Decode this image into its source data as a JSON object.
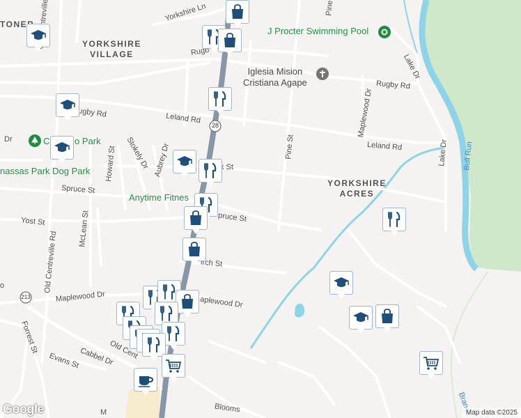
{
  "map": {
    "areas": [
      {
        "id": "yorkshire-village",
        "line1": "YORKSHIRE",
        "line2": "VILLAGE"
      },
      {
        "id": "yorkshire-acres",
        "line1": "YORKSHIRE",
        "line2": "ACRES"
      },
      {
        "id": "toner-partial",
        "line1": "TONER",
        "line2": ""
      }
    ],
    "streets": {
      "yorkshire_ln": "Yorkshire Ln",
      "old_centreville_rd": "Old Centreville Rd",
      "old_centreville_rd_2": "Old Centreville Rd",
      "rugby_partial": "Rugb",
      "rugby_rd_left": "ugby Rd",
      "rugby_rd_right": "Rugby Rd",
      "leland_rd_left": "Leland Rd",
      "leland_rd_right": "Leland Rd",
      "lake_dr_top": "Lake Dr",
      "lake_dr_right": "Lake Dr",
      "maplewood_dr_ne": "Maplewood Dr",
      "maplewood_dr_left": "Maplewood Dr",
      "maplewood_dr_mid": "aplewood Dr",
      "pine_st_top": "Pine",
      "pine_st": "Pine St",
      "howard_st": "Howard St",
      "stokely_dr": "Stokely Dr",
      "aubrey_dr": "Aubrey Dr",
      "spruce_st_left": "Spruce St",
      "spruce_st_mid": "pruce St",
      "yost_st": "Yost St",
      "mclean_st": "McLean St",
      "birch_st": "irch St",
      "k_st": "k St",
      "evans_st": "Evans St",
      "cabbel_dr": "Cabbel Dr",
      "forrest_st": "Forrest St",
      "blooms": "Blooms",
      "old_cent_partial": "Old Cent",
      "dr_partial": "Dr",
      "m_partial": "M",
      "branch": "Branch",
      "o_partial": "o"
    },
    "pois": {
      "swimming_pool": "J Procter Swimming Pool",
      "church_line1": "Iglesia Mision",
      "church_line2": "Cristiana Agape",
      "park": "C",
      "park_suffix": "o Park",
      "dog_park": "nassas Park Dog Park",
      "fitness": "Anytime Fitnes"
    },
    "streams": {
      "bull_run": "Bull Run"
    },
    "route_shields": {
      "r28": "28",
      "r213": "213"
    },
    "colors": {
      "background": "#f4f3f1",
      "park_green": "#cfe8c9",
      "water": "#8fd3e6",
      "highway": "#8896a7",
      "pin_icon": "#1e4e79",
      "poi_green": "#1e8e3e",
      "poi_gray": "#757575"
    },
    "attribution": "Map data ©2025",
    "logo": "Google"
  },
  "markers": [
    {
      "name": "restaurant-marker",
      "icon": "fork-knife"
    },
    {
      "name": "shopping-marker",
      "icon": "shopping-bag"
    },
    {
      "name": "school-marker",
      "icon": "graduation-cap"
    },
    {
      "name": "cafe-marker",
      "icon": "coffee-cup"
    },
    {
      "name": "grocery-marker",
      "icon": "shopping-cart"
    }
  ]
}
